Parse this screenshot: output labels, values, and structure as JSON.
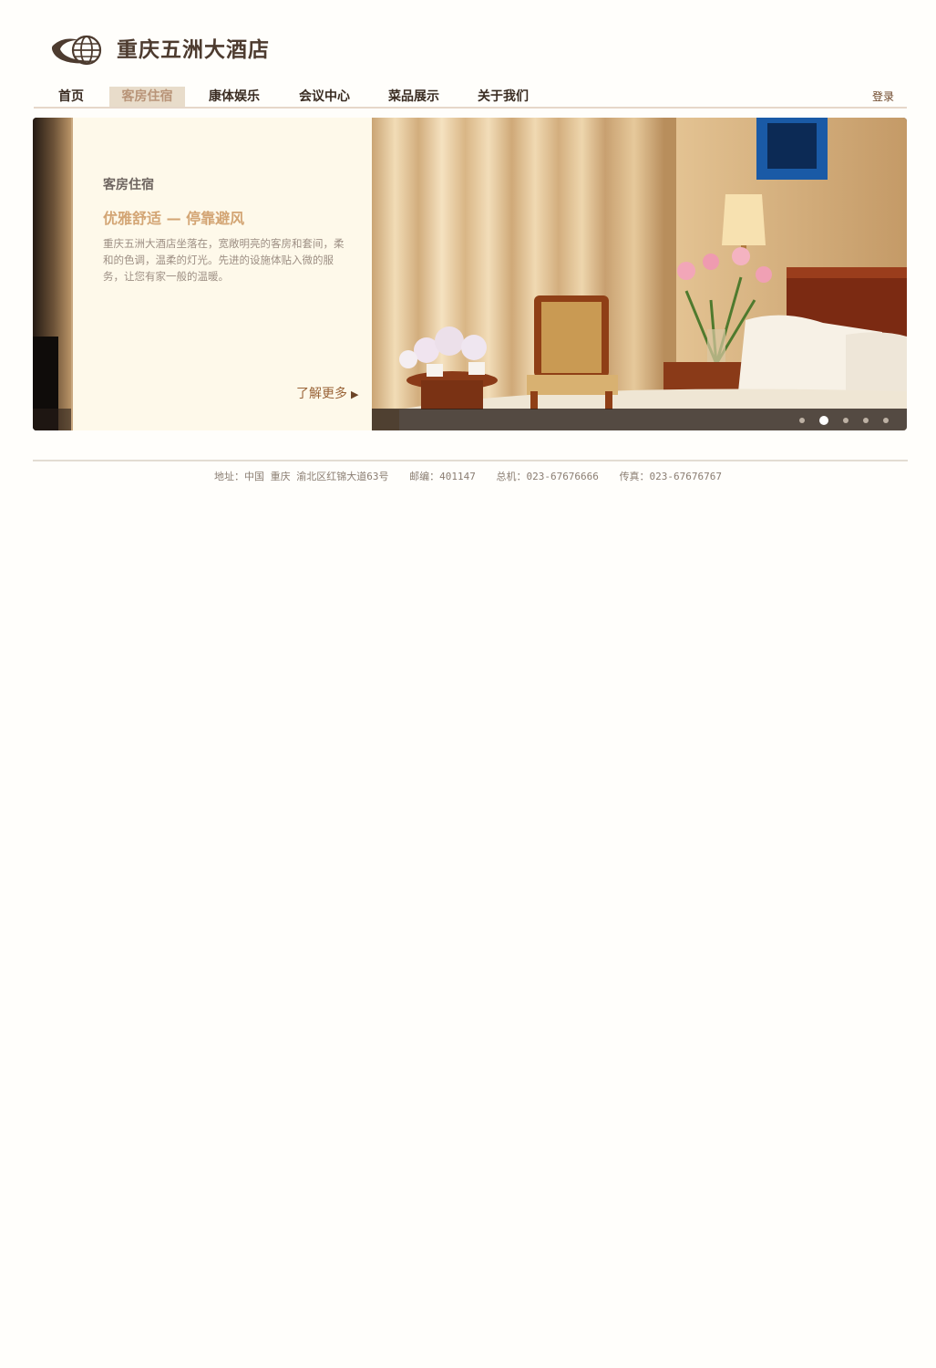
{
  "site": {
    "name": "重庆五洲大酒店",
    "logo_icon": "globe-icon"
  },
  "nav": {
    "items": [
      {
        "label": "首页",
        "active": false
      },
      {
        "label": "客房住宿",
        "active": true
      },
      {
        "label": "康体娱乐",
        "active": false
      },
      {
        "label": "会议中心",
        "active": false
      },
      {
        "label": "菜品展示",
        "active": false
      },
      {
        "label": "关于我们",
        "active": false
      }
    ],
    "login_label": "登录"
  },
  "banner": {
    "section_title": "客房住宿",
    "headline": "优雅舒适 — 停靠避风",
    "description": "重庆五洲大酒店坐落在，宽敞明亮的客房和套间，柔和的色调，温柔的灯光。先进的设施体贴入微的服务，让您有家一般的温暖。",
    "more_label": "了解更多",
    "more_icon": "play-triangle-icon",
    "slide_count": 5,
    "active_slide": 2
  },
  "footer": {
    "address": "地址：中国 重庆 渝北区红锦大道63号",
    "postcode": "邮编：401147",
    "phone": "总机：023-67676666",
    "fax": "传真：023-67676767"
  },
  "colors": {
    "brand": "#4d3b2f",
    "nav_active_bg": "#e8dcca",
    "headline": "#d3a574",
    "panel_bg": "#fef9ea"
  }
}
